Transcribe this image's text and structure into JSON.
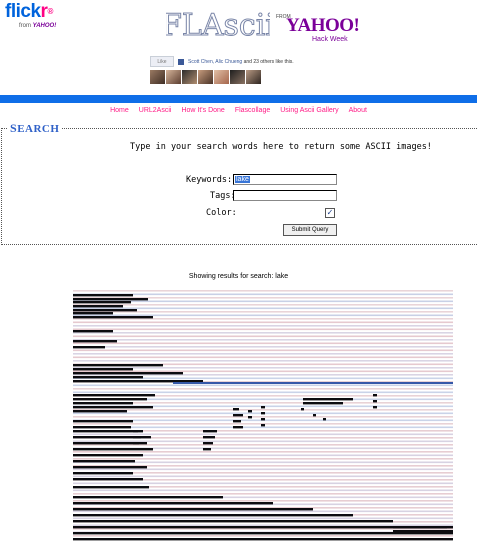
{
  "flickr": {
    "logo_fl": "flick",
    "logo_r": "r",
    "from_text": "from",
    "from_brand": "YAHOO!"
  },
  "flascii": {
    "logo_text": "FLAscii",
    "from_label": "FROM",
    "yahoo": "YAHOO!",
    "hackweek": "Hack Week"
  },
  "like_widget": {
    "button": "Like",
    "names": "Scott Chen, Alic Chueng",
    "rest": " and 23 others like this."
  },
  "nav": {
    "items": [
      "Home",
      "URL2Ascii",
      "How It's Done",
      "Flascollage",
      "Using Ascii Gallery",
      "About"
    ]
  },
  "search": {
    "legend_first": "S",
    "legend_rest": "EARCH",
    "intro": "Type in your search words here to return some ASCII images!",
    "keywords_label": "Keywords:",
    "keywords_value": "lake",
    "tags_label": "Tags:",
    "tags_value": "",
    "color_label": "Color:",
    "color_checked": true,
    "submit_label": "Submit Query"
  },
  "results": {
    "caption": "Showing results for search: lake"
  },
  "colors": {
    "flickr_blue": "#0063dc",
    "flickr_pink": "#ff0084",
    "yahoo_purple": "#7b0099",
    "bar_blue": "#0f6ee8",
    "nav_pink": "#ff1b86",
    "legend_blue": "#2f61c8"
  }
}
